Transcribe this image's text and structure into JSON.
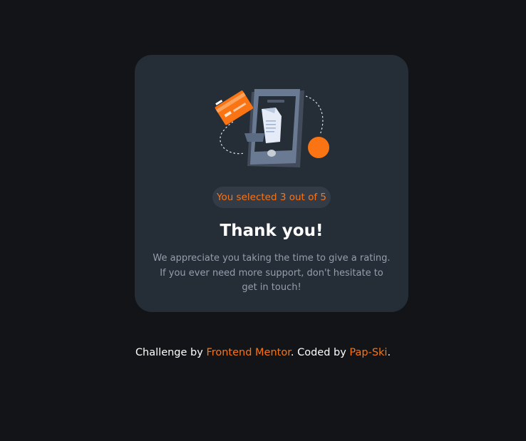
{
  "card": {
    "illustration_icon": "phone-receipt-card-illustration",
    "badge_text": "You selected 3 out of 5",
    "title": "Thank you!",
    "description": "We appreciate you taking the time to give a rating. If you ever need more support, don't hesitate to get in touch!"
  },
  "footer": {
    "prefix": "Challenge by ",
    "link1": "Frontend Mentor",
    "middle": ". Coded by ",
    "link2": "Pap-Ski",
    "suffix": "."
  },
  "colors": {
    "background": "#121417",
    "card": "#252d37",
    "accent": "#fb7413",
    "badge_bg": "#323b46",
    "text_muted": "#959eac"
  }
}
